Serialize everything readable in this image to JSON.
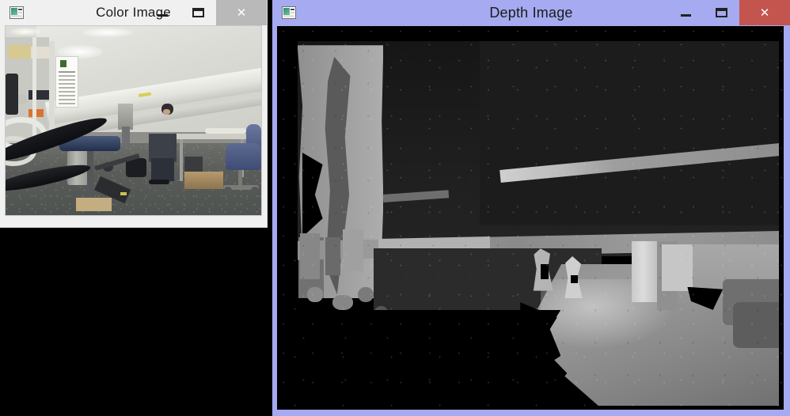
{
  "desktop": {
    "background_color": "#000000"
  },
  "windows": [
    {
      "id": "color-image",
      "title": "Color Image",
      "state": "inactive",
      "titlebar_color": "#f0f0f0",
      "title_text_color": "#1b1b1b",
      "close_button_color": "#b9b9b9",
      "icon": "image-window-icon",
      "buttons": {
        "minimize": "—",
        "maximize": "❐",
        "close": "×"
      },
      "content": {
        "type": "camera-color-frame",
        "description": "Indoor workshop / laboratory photograph: white wall and ceiling lights at top, a long horizontal white shelf beam crossing the scene, a printed paper sign on a post at left, metal shelving with boxes, a blue-topped drill press in the foreground, a person bending over at center, a table with clutter and a blue office chair at right, speckled grey carpet floor, and black hoses in the lower-left foreground."
      }
    },
    {
      "id": "depth-image",
      "title": "Depth Image",
      "state": "active",
      "titlebar_color": "#a6aaf0",
      "title_text_color": "#1b1b1b",
      "close_button_color": "#c4544e",
      "icon": "image-window-icon",
      "buttons": {
        "minimize": "—",
        "maximize": "❐",
        "close": "×"
      },
      "content": {
        "type": "camera-depth-frame",
        "description": "Grayscale depth map of the same scene: black (no-return) regions at top and lower left, a bright vertical column of near-range shelving at the left, a thin bright diagonal beam in the upper right, a horizontal mid-grey shelf band across the middle, a dark table block at center-left, and a bright gradient floor wedge with person silhouettes in the lower right.",
        "colormap": "grayscale",
        "background_color": "#000000"
      }
    }
  ]
}
